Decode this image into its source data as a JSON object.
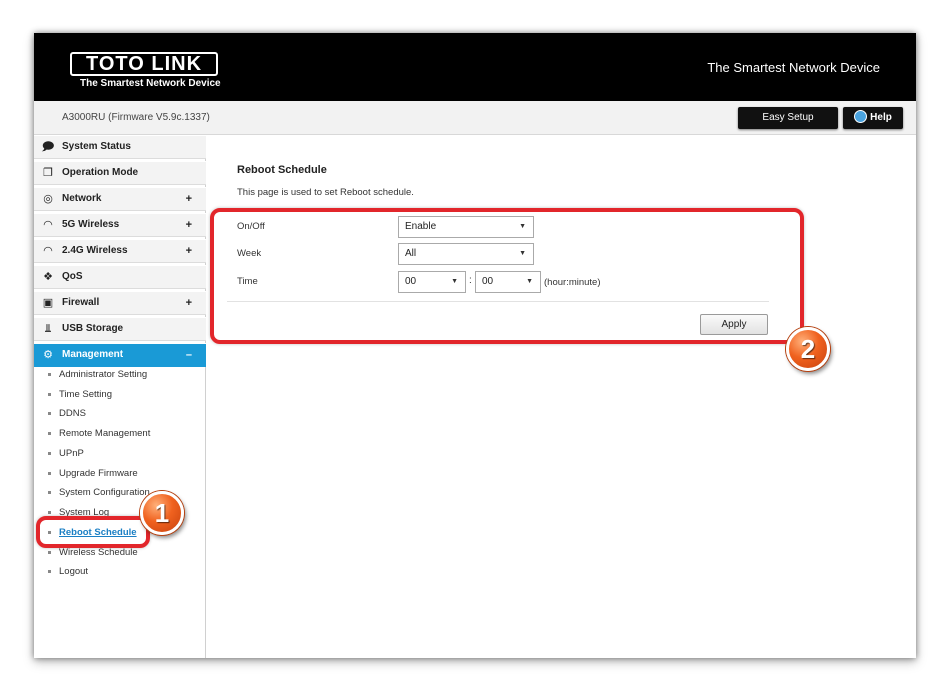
{
  "header": {
    "logo_text": "TOTO LINK",
    "logo_tagline": "The Smartest Network Device",
    "tagline": "The Smartest Network Device"
  },
  "subbar": {
    "firmware": "A3000RU (Firmware V5.9c.1337)",
    "easy_setup_label": "Easy Setup",
    "help_label": "Help"
  },
  "sidebar": {
    "menu": [
      {
        "label": "System Status",
        "icon": "chat-icon",
        "expandable": false
      },
      {
        "label": "Operation Mode",
        "icon": "windows-icon",
        "expandable": false
      },
      {
        "label": "Network",
        "icon": "globe-icon",
        "expandable": true,
        "toggle": "+"
      },
      {
        "label": "5G Wireless",
        "icon": "wifi-icon",
        "expandable": true,
        "toggle": "+"
      },
      {
        "label": "2.4G Wireless",
        "icon": "wifi-icon",
        "expandable": true,
        "toggle": "+"
      },
      {
        "label": "QoS",
        "icon": "qos-icon",
        "expandable": false
      },
      {
        "label": "Firewall",
        "icon": "lock-icon",
        "expandable": true,
        "toggle": "+"
      },
      {
        "label": "USB Storage",
        "icon": "usb-icon",
        "expandable": false
      },
      {
        "label": "Management",
        "icon": "gear-icon",
        "expandable": true,
        "toggle": "–",
        "active": true
      }
    ],
    "submenu": [
      "Administrator Setting",
      "Time Setting",
      "DDNS",
      "Remote Management",
      "UPnP",
      "Upgrade Firmware",
      "System Configuration",
      "System Log",
      "Reboot Schedule",
      "Wireless Schedule",
      "Logout"
    ],
    "current_submenu": "Reboot Schedule"
  },
  "content": {
    "title": "Reboot Schedule",
    "description": "This page is used to set Reboot schedule.",
    "fields": {
      "onoff_label": "On/Off",
      "onoff_value": "Enable",
      "week_label": "Week",
      "week_value": "All",
      "time_label": "Time",
      "hour_value": "00",
      "minute_value": "00",
      "time_separator": ":",
      "time_hint": "(hour:minute)"
    },
    "apply_label": "Apply"
  },
  "annotations": {
    "badge_1": "1",
    "badge_2": "2"
  },
  "colors": {
    "header_bg": "#000000",
    "active_menu": "#1a9ad6",
    "highlight": "#e2262b",
    "badge": "#f0621f"
  }
}
